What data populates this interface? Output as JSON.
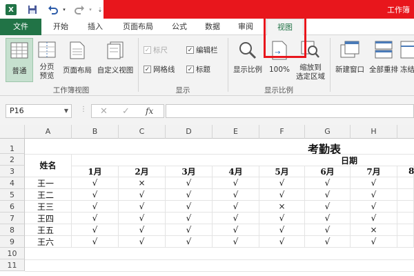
{
  "app": {
    "logo": "X",
    "window_title": "工作簿"
  },
  "quick_access": {
    "save": "save-icon",
    "undo": "undo-icon",
    "redo": "redo-icon",
    "more": "customize-icon"
  },
  "tabs": [
    {
      "label": "文件"
    },
    {
      "label": "开始"
    },
    {
      "label": "插入"
    },
    {
      "label": "页面布局"
    },
    {
      "label": "公式"
    },
    {
      "label": "数据"
    },
    {
      "label": "审阅"
    },
    {
      "label": "视图"
    }
  ],
  "ribbon": {
    "workbook_views": {
      "label": "工作簿视图",
      "buttons": [
        {
          "label": "普通"
        },
        {
          "label": "分页\n预览"
        },
        {
          "label": "页面布局"
        },
        {
          "label": "自定义视图"
        }
      ]
    },
    "show": {
      "label": "显示",
      "items": [
        {
          "label": "标尺",
          "checked": true,
          "disabled": true
        },
        {
          "label": "编辑栏",
          "checked": true
        },
        {
          "label": "网格线",
          "checked": true
        },
        {
          "label": "标题",
          "checked": true
        }
      ]
    },
    "zoom": {
      "label": "显示比例",
      "buttons": [
        {
          "label": "显示比例"
        },
        {
          "label": "100%"
        },
        {
          "label": "缩放到\n选定区域"
        }
      ]
    },
    "window": {
      "buttons": [
        {
          "label": "新建窗口"
        },
        {
          "label": "全部重排"
        },
        {
          "label": "冻结"
        }
      ]
    }
  },
  "formula_bar": {
    "name_box": "P16",
    "fx": "fx",
    "value": ""
  },
  "columns": [
    "A",
    "B",
    "C",
    "D",
    "E",
    "F",
    "G",
    "H"
  ],
  "rows": [
    "1",
    "2",
    "3",
    "4",
    "5",
    "6",
    "7",
    "8",
    "9",
    "10",
    "11"
  ],
  "sheet": {
    "title": "考勤表",
    "date_header": "日期",
    "name_header": "姓名",
    "months": [
      "1月",
      "2月",
      "3月",
      "4月",
      "5月",
      "6月",
      "7月"
    ],
    "employees": [
      {
        "name": "王一",
        "marks": [
          "√",
          "×",
          "√",
          "√",
          "√",
          "√",
          "√"
        ]
      },
      {
        "name": "王二",
        "marks": [
          "√",
          "√",
          "√",
          "√",
          "√",
          "√",
          "√"
        ]
      },
      {
        "name": "王三",
        "marks": [
          "√",
          "√",
          "√",
          "√",
          "×",
          "√",
          "√"
        ]
      },
      {
        "name": "王四",
        "marks": [
          "√",
          "√",
          "√",
          "√",
          "√",
          "√",
          "√"
        ]
      },
      {
        "name": "王五",
        "marks": [
          "√",
          "√",
          "√",
          "√",
          "√",
          "√",
          "×"
        ]
      },
      {
        "name": "王六",
        "marks": [
          "√",
          "√",
          "√",
          "√",
          "√",
          "√",
          "√"
        ]
      }
    ],
    "extra_header": "8"
  }
}
